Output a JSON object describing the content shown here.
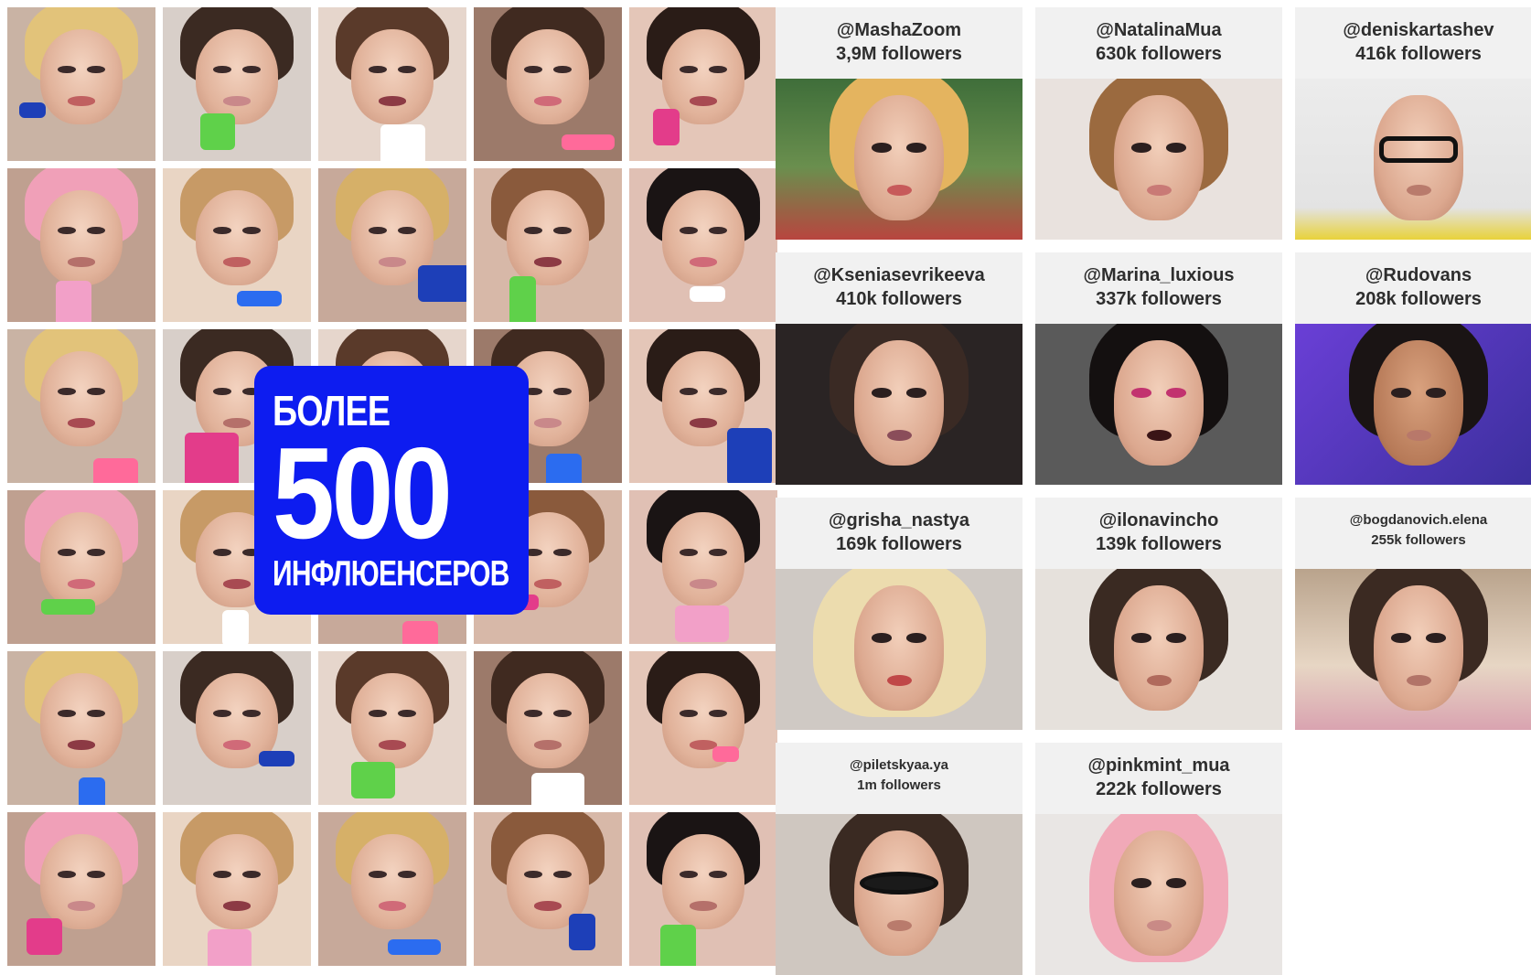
{
  "badge": {
    "line1": "БОЛЕЕ",
    "number": "500",
    "line3": "ИНФЛЮЕНСЕРОВ",
    "color": "#0d1cf0"
  },
  "influencers": [
    {
      "handle": "@MashaZoom",
      "followers": "3,9M followers"
    },
    {
      "handle": "@NatalinaMua",
      "followers": "630k followers"
    },
    {
      "handle": "@deniskartashev",
      "followers": "416k followers"
    },
    {
      "handle": "@Kseniasevrikeeva",
      "followers": "410k followers"
    },
    {
      "handle": "@Marina_luxious",
      "followers": "337k followers"
    },
    {
      "handle": "@Rudovans",
      "followers": "208k followers"
    },
    {
      "handle": "@grisha_nastya",
      "followers": "169k followers"
    },
    {
      "handle": "@ilonavincho",
      "followers": "139k followers"
    },
    {
      "handle": "@bogdanovich.elena",
      "followers": "255k followers"
    },
    {
      "handle": "@piletskyaa.ya",
      "followers": "1m followers"
    },
    {
      "handle": "@pinkmint_mua",
      "followers": "222k followers"
    }
  ],
  "photo_grid": {
    "columns": 5,
    "rows": 6
  }
}
